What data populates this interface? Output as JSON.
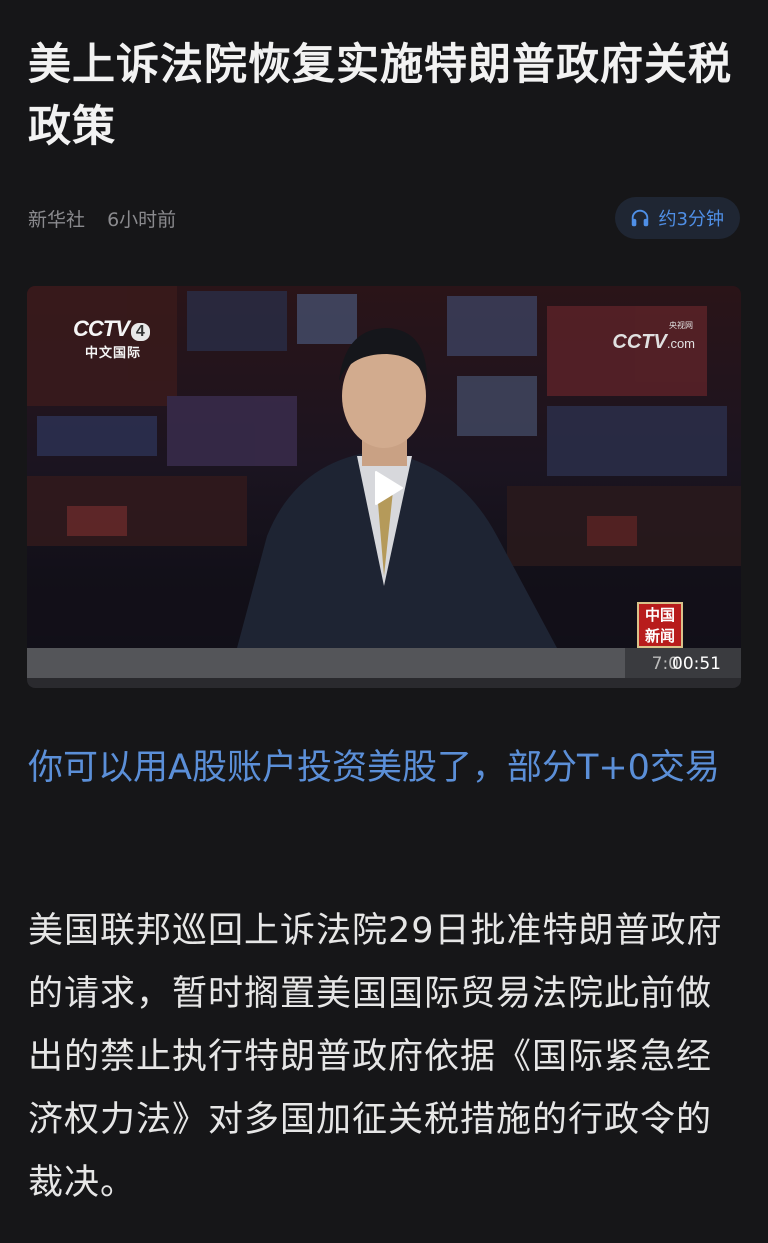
{
  "article": {
    "title": "美上诉法院恢复实施特朗普政府关税政策",
    "source": "新华社",
    "time": "6小时前",
    "listen_label": "约3分钟"
  },
  "video": {
    "channel_brand": "CCTV",
    "channel_number": "4",
    "channel_sub": "中文国际",
    "site_small": "央视网",
    "site_brand": "CCTV",
    "site_suffix": ".com",
    "news_logo_line1": "中国",
    "news_logo_line2": "新闻",
    "duration": "00:51",
    "partial_time": "7:0"
  },
  "related": {
    "link_text": "你可以用A股账户投资美股了，部分T+0交易"
  },
  "body": {
    "paragraph": "美国联邦巡回上诉法院29日批准特朗普政府的请求，暂时搁置美国国际贸易法院此前做出的禁止执行特朗普政府依据《国际紧急经济权力法》对多国加征关税措施的行政令的裁决。"
  },
  "colors": {
    "background": "#161618",
    "link": "#5b8fd8",
    "accent": "#4f8fe6"
  }
}
